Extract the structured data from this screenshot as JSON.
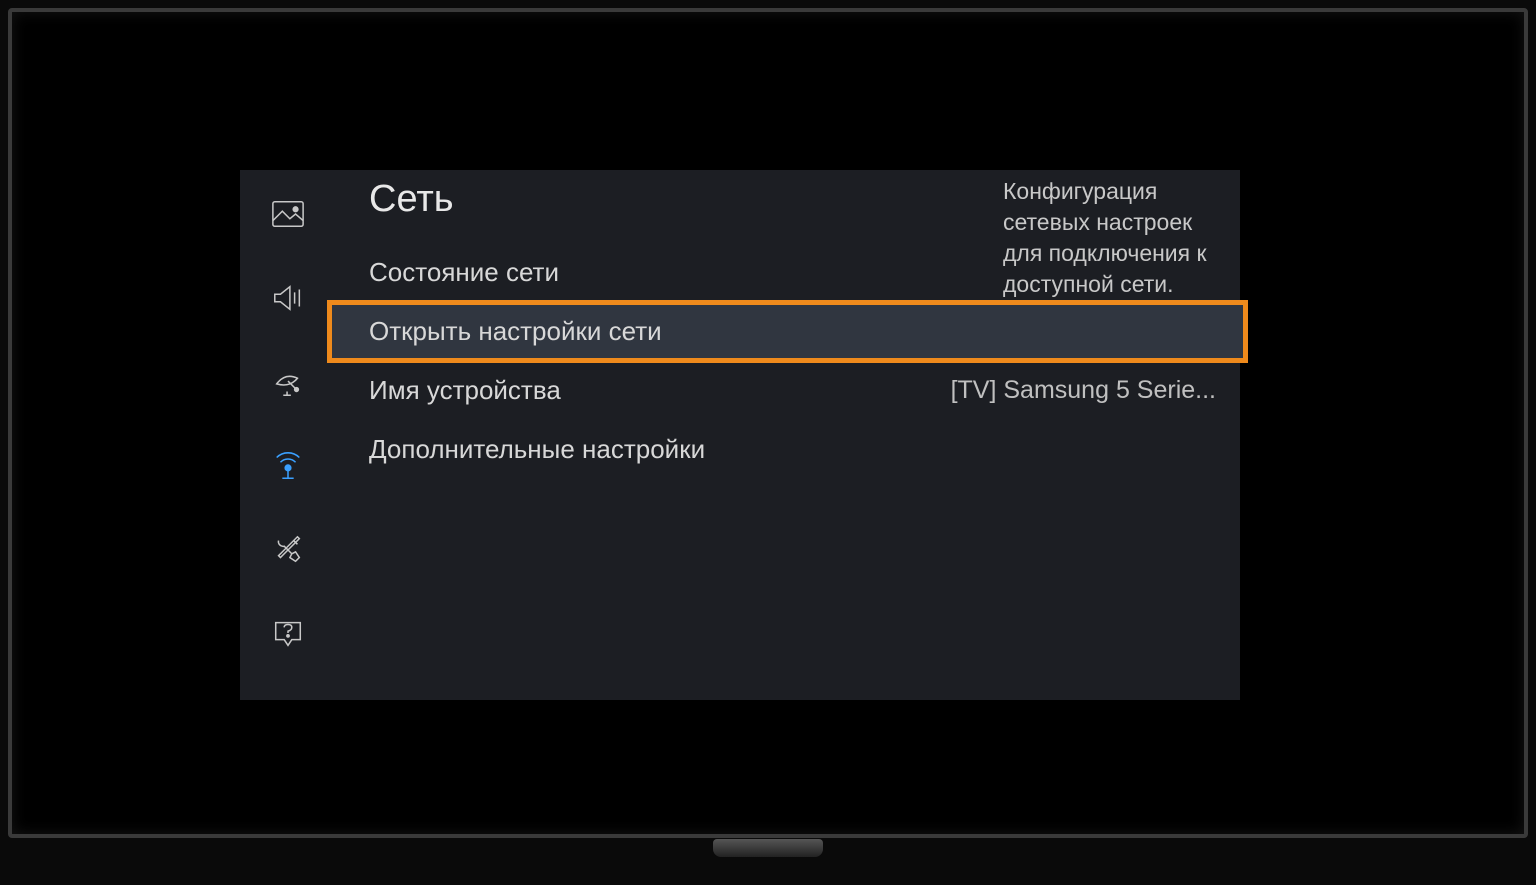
{
  "header": {
    "title": "Сеть"
  },
  "sidebar": {
    "items": [
      {
        "name": "picture",
        "active": false
      },
      {
        "name": "sound",
        "active": false
      },
      {
        "name": "broadcast",
        "active": false
      },
      {
        "name": "network",
        "active": true
      },
      {
        "name": "system",
        "active": false
      },
      {
        "name": "support",
        "active": false
      }
    ]
  },
  "menu": {
    "items": [
      {
        "label": "Состояние сети",
        "value": "",
        "selected": false
      },
      {
        "label": "Открыть настройки сети",
        "value": "",
        "selected": true
      },
      {
        "label": "Имя устройства",
        "value": "[TV] Samsung 5 Serie...",
        "selected": false
      },
      {
        "label": "Дополнительные настройки",
        "value": "",
        "selected": false
      }
    ]
  },
  "description": "Конфигурация сетевых настроек для подключения к доступной сети.",
  "colors": {
    "highlight": "#ee8a1c",
    "active_icon": "#3aa0ff",
    "panel_bg": "#1c1e23"
  }
}
